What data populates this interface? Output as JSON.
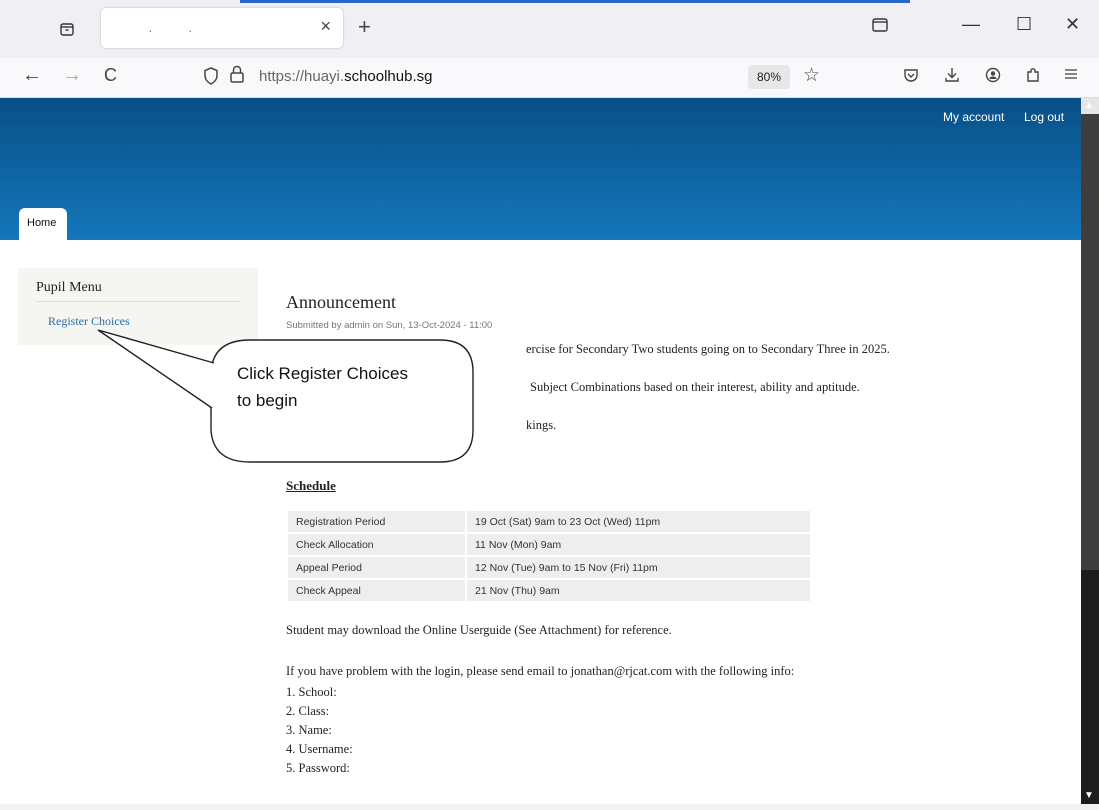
{
  "browser": {
    "tab_title": " .          .",
    "tab_close": "×",
    "new_tab": "+",
    "back": "←",
    "forward": "→",
    "reload": "C",
    "url_prefix": "https://huayi.",
    "url_domain": "schoolhub.sg",
    "zoom": "80%",
    "minimize": "—",
    "maximize": "☐",
    "close": "✕",
    "icons": [
      "tab-list-icon",
      "shield-icon",
      "lock-icon",
      "star-icon",
      "pocket-icon",
      "download-icon",
      "account-icon",
      "extensions-icon",
      "menu-icon"
    ]
  },
  "header": {
    "my_account": "My account",
    "log_out": "Log out",
    "home_tab": "Home",
    "bg_top": "#0a4f87",
    "bg_bottom": "#1478bb"
  },
  "sidebar": {
    "title": "Pupil Menu",
    "items": [
      {
        "label": "Register Choices"
      }
    ]
  },
  "announcement": {
    "title": "Announcement",
    "submitted": "Submitted by admin on Sun, 13-Oct-2024 - 11:00",
    "line1": "ercise for Secondary Two students going on to Secondary Three in 2025.",
    "line2": "Subject Combinations based on their interest, ability and aptitude.",
    "line3": "kings.",
    "schedule_heading": "Schedule",
    "schedule": [
      {
        "label": "Registration Period",
        "value": "19 Oct (Sat) 9am to 23 Oct (Wed) 11pm"
      },
      {
        "label": "Check Allocation",
        "value": "11 Nov (Mon) 9am"
      },
      {
        "label": "Appeal Period",
        "value": "12 Nov (Tue) 9am to 15 Nov (Fri) 11pm"
      },
      {
        "label": "Check Appeal",
        "value": "21 Nov (Thu) 9am"
      }
    ],
    "download_note": "Student may download the Online Userguide (See Attachment) for reference.",
    "problem_note": "If you have problem with the login, please send email to jonathan@rjcat.com with the following info:",
    "info_items": [
      "1. School:",
      "2. Class:",
      "3. Name:",
      "4. Username:",
      "5. Password:"
    ]
  },
  "callout": {
    "line1": "Click Register Choices",
    "line2": "to begin"
  }
}
